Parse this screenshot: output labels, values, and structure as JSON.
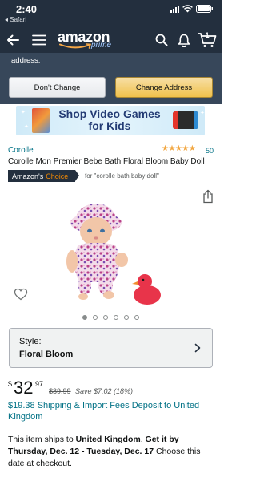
{
  "status_bar": {
    "time": "2:40",
    "back_label": "◂ Safari"
  },
  "header": {
    "logo_text": "amazon",
    "logo_sub": "prime",
    "cart_count": "1"
  },
  "address_banner": {
    "text": "address.",
    "dont_change_label": "Don't Change",
    "change_label": "Change Address"
  },
  "promo": {
    "text": "Shop Video Games for Kids"
  },
  "product": {
    "brand": "Corolle",
    "stars": "★★★★★",
    "rating_count": "50",
    "title": "Corolle Mon Premier Bebe Bath Floral Bloom Baby Doll",
    "choice_label": "Amazon's",
    "choice_highlight": "Choice",
    "choice_for": "for \"corolle bath baby doll\""
  },
  "carousel": {
    "dot_count": 6,
    "active_index": 0
  },
  "style": {
    "label": "Style:",
    "value": "Floral Bloom"
  },
  "price": {
    "symbol": "$",
    "whole": "32",
    "fraction": "97",
    "list_price": "$39.99",
    "savings": "Save $7.02 (18%)"
  },
  "shipping": {
    "text": "$19.38 Shipping & Import Fees Deposit to United Kingdom"
  },
  "delivery": {
    "part1": "This item ships to ",
    "country": "United Kingdom",
    "part2": ". ",
    "get_it": "Get it by Thursday, Dec. 12 - Tuesday, Dec. 17",
    "part3": " Choose this date at checkout."
  },
  "colors": {
    "header_bg": "#232f3e",
    "banner_bg": "#37475a",
    "link": "#007185",
    "star": "#f2a742",
    "choice_orange": "#f08804",
    "button_yellow": "#f0c14b"
  },
  "icons": [
    "back-arrow-icon",
    "menu-icon",
    "search-icon",
    "bell-icon",
    "cart-icon",
    "share-icon",
    "heart-icon",
    "chevron-right-icon"
  ]
}
